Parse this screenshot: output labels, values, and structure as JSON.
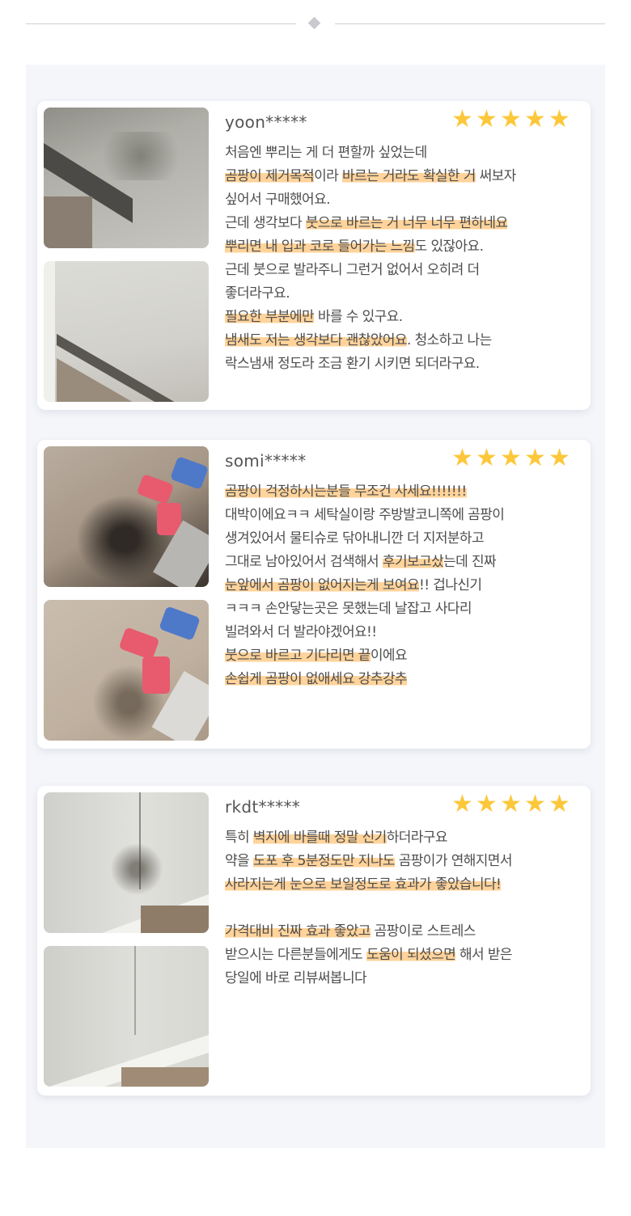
{
  "colors": {
    "star": "#fcc73a",
    "highlight": "#ffc478",
    "panel": "#f4f6fa"
  },
  "reviews": [
    {
      "user": "yoon*****",
      "stars": 5,
      "images": [
        "wall-mold-before",
        "wall-after"
      ],
      "lines": [
        [
          {
            "t": "처음엔 뿌리는 게 더 편할까 싶었는데",
            "h": false
          }
        ],
        [
          {
            "t": "곰팡이 제거목적",
            "h": true
          },
          {
            "t": "이라 ",
            "h": false
          },
          {
            "t": "바르는 거라도 확실한 거",
            "h": true
          },
          {
            "t": " 써보자",
            "h": false
          }
        ],
        [
          {
            "t": "싶어서 구매했어요.",
            "h": false
          }
        ],
        [
          {
            "t": "근데 생각보다 ",
            "h": false
          },
          {
            "t": "붓으로 바르는 거 너무 너무 편하네요",
            "h": true
          }
        ],
        [
          {
            "t": "뿌리면 내 입과 코로 들어가는 느낌",
            "h": true
          },
          {
            "t": "도 있잖아요.",
            "h": false
          }
        ],
        [
          {
            "t": "근데 붓으로 발라주니 그런거 없어서 오히려 더",
            "h": false
          }
        ],
        [
          {
            "t": "좋더라구요.",
            "h": false
          }
        ],
        [
          {
            "t": "필요한 부분에만",
            "h": true
          },
          {
            "t": " 바를 수 있구요.",
            "h": false
          }
        ],
        [
          {
            "t": "냄새도 저는 생각보다 괜찮았어요",
            "h": true
          },
          {
            "t": ". 청소하고 나는",
            "h": false
          }
        ],
        [
          {
            "t": "락스냄새 정도라 조금 환기 시키면 되더라구요.",
            "h": false
          }
        ]
      ]
    },
    {
      "user": "somi*****",
      "stars": 5,
      "images": [
        "pipe-mold-before",
        "pipe-after"
      ],
      "lines": [
        [
          {
            "t": "곰팡이 걱정하시는분들 무조건 사세요!!!!!!!",
            "h": true
          }
        ],
        [
          {
            "t": "대박이에요ㅋㅋ 세탁실이랑 주방발코니쪽에 곰팡이",
            "h": false
          }
        ],
        [
          {
            "t": "생겨있어서 물티슈로 닦아내니깐 더 지저분하고",
            "h": false
          }
        ],
        [
          {
            "t": "그대로 남아있어서 검색해서 ",
            "h": false
          },
          {
            "t": "후기보고샀",
            "h": true
          },
          {
            "t": "는데 진짜",
            "h": false
          }
        ],
        [
          {
            "t": "눈앞에서 곰팡이 없어지는게 보여요",
            "h": true
          },
          {
            "t": "!! 겁나신기",
            "h": false
          }
        ],
        [
          {
            "t": "ㅋㅋㅋ 손안닿는곳은 못했는데 날잡고 사다리",
            "h": false
          }
        ],
        [
          {
            "t": "빌려와서 더 발라야겠어요!!",
            "h": false
          }
        ],
        [
          {
            "t": "붓으로 바르고 기다리면 끝",
            "h": true
          },
          {
            "t": "이에요",
            "h": false
          }
        ],
        [
          {
            "t": "손쉽게 곰팡이 없애세요 강추강추",
            "h": true
          }
        ]
      ]
    },
    {
      "user": "rkdt*****",
      "stars": 5,
      "images": [
        "corner-mold-before",
        "corner-after"
      ],
      "lines": [
        [
          {
            "t": "특히 ",
            "h": false
          },
          {
            "t": "벽지에 바를때 정말 신기",
            "h": true
          },
          {
            "t": "하더라구요",
            "h": false
          }
        ],
        [
          {
            "t": "약을 ",
            "h": false
          },
          {
            "t": "도포 후 5분정도만 지나도",
            "h": true
          },
          {
            "t": " 곰팡이가 연해지면서",
            "h": false
          }
        ],
        [
          {
            "t": "사라지는게 눈으로 보일정도로 효과가 좋았습니다!",
            "h": true
          }
        ],
        [
          {
            "t": "",
            "h": false
          }
        ],
        [
          {
            "t": "가격대비 진짜 효과 좋았고",
            "h": true
          },
          {
            "t": " 곰팡이로 스트레스",
            "h": false
          }
        ],
        [
          {
            "t": "받으시는 다른분들에게도 ",
            "h": false
          },
          {
            "t": "도움이 되셨으면",
            "h": true
          },
          {
            "t": " 해서 받은",
            "h": false
          }
        ],
        [
          {
            "t": "당일에 바로 리뷰써봅니다",
            "h": false
          }
        ]
      ]
    }
  ]
}
